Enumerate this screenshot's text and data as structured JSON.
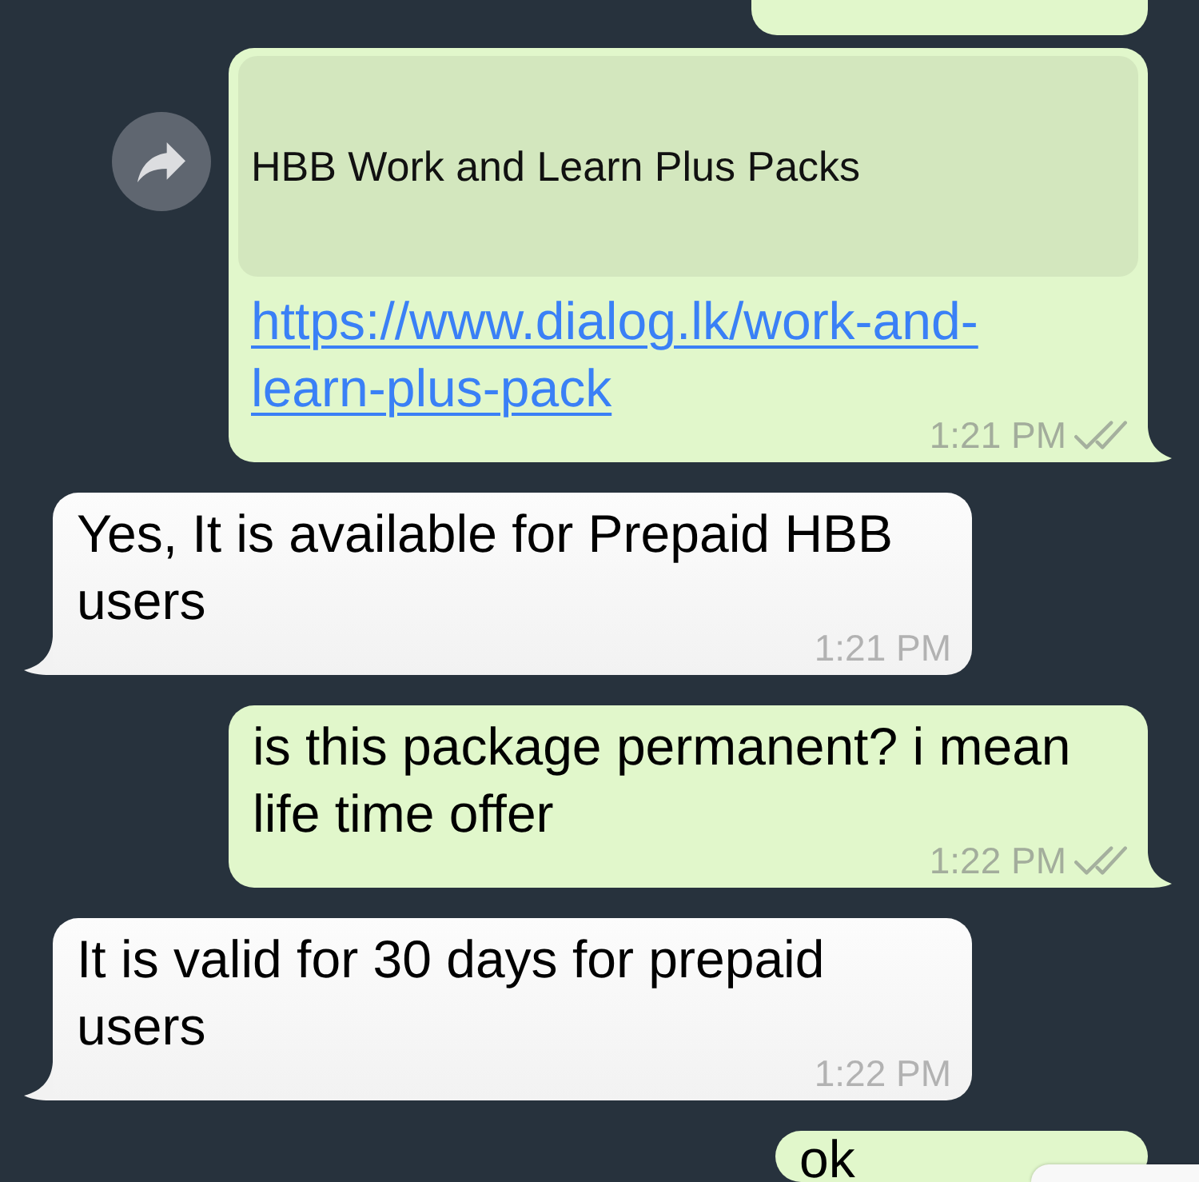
{
  "messages": [
    {
      "kind": "partial",
      "outgoing": true
    },
    {
      "kind": "link",
      "outgoing": true,
      "forward_button": true,
      "preview_title": "HBB Work and Learn Plus Packs",
      "url": "https://www.dialog.lk/work-and-learn-plus-pack",
      "time": "1:21 PM",
      "delivered": true
    },
    {
      "kind": "text",
      "outgoing": false,
      "text": "Yes, It is available for Prepaid HBB users",
      "time": "1:21 PM"
    },
    {
      "kind": "text",
      "outgoing": true,
      "text": "is this package permanent? i mean life time offer",
      "time": "1:22 PM",
      "delivered": true
    },
    {
      "kind": "text",
      "outgoing": false,
      "text": "It is valid for 30 days for prepaid users",
      "time": "1:22 PM"
    },
    {
      "kind": "text",
      "outgoing": true,
      "text": "ok"
    }
  ]
}
